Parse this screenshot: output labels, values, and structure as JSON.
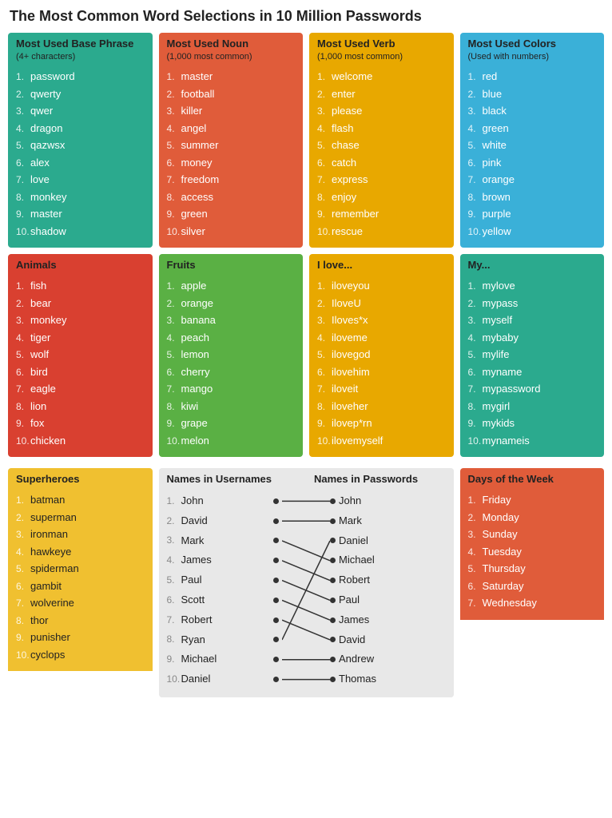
{
  "title": "The Most Common Word Selections in 10 Million Passwords",
  "sections": [
    {
      "id": "base-phrase",
      "header": "Most Used Base Phrase",
      "subheader": "(4+ characters)",
      "headerBg": "color-teal",
      "listBg": "color-teal",
      "items": [
        "password",
        "qwerty",
        "qwer",
        "dragon",
        "qazwsx",
        "alex",
        "love",
        "monkey",
        "master",
        "shadow"
      ]
    },
    {
      "id": "nouns",
      "header": "Most Used Noun",
      "subheader": "(1,000 most common)",
      "headerBg": "color-orange-red",
      "listBg": "color-orange-red",
      "items": [
        "master",
        "football",
        "killer",
        "angel",
        "summer",
        "money",
        "freedom",
        "access",
        "green",
        "silver"
      ]
    },
    {
      "id": "verbs",
      "header": "Most Used Verb",
      "subheader": "(1,000 most common)",
      "headerBg": "color-gold",
      "listBg": "color-gold",
      "items": [
        "welcome",
        "enter",
        "please",
        "flash",
        "chase",
        "catch",
        "express",
        "enjoy",
        "remember",
        "rescue"
      ]
    },
    {
      "id": "colors",
      "header": "Most Used Colors",
      "subheader": "(Used with numbers)",
      "headerBg": "color-blue",
      "listBg": "color-blue",
      "items": [
        "red",
        "blue",
        "black",
        "green",
        "white",
        "pink",
        "orange",
        "brown",
        "purple",
        "yellow"
      ]
    },
    {
      "id": "animals",
      "header": "Animals",
      "subheader": "",
      "headerBg": "color-red",
      "listBg": "color-red",
      "items": [
        "fish",
        "bear",
        "monkey",
        "tiger",
        "wolf",
        "bird",
        "eagle",
        "lion",
        "fox",
        "chicken"
      ]
    },
    {
      "id": "fruits",
      "header": "Fruits",
      "subheader": "",
      "headerBg": "color-green",
      "listBg": "color-green",
      "items": [
        "apple",
        "orange",
        "banana",
        "peach",
        "lemon",
        "cherry",
        "mango",
        "kiwi",
        "grape",
        "melon"
      ]
    },
    {
      "id": "ilove",
      "header": "I love...",
      "subheader": "",
      "headerBg": "color-gold",
      "listBg": "color-gold",
      "items": [
        "iloveyou",
        "IloveU",
        "Iloves*x",
        "iloveme",
        "ilovegod",
        "ilovehim",
        "iloveit",
        "iloveher",
        "ilovep*rn",
        "ilovemyself"
      ]
    },
    {
      "id": "my",
      "header": "My...",
      "subheader": "",
      "headerBg": "color-teal",
      "listBg": "color-teal",
      "items": [
        "mylove",
        "mypass",
        "myself",
        "mybaby",
        "mylife",
        "myname",
        "mypassword",
        "mygirl",
        "mykids",
        "mynameis"
      ]
    },
    {
      "id": "superheroes",
      "header": "Superheroes",
      "subheader": "",
      "headerBg": "color-yellow",
      "listBg": "color-yellow",
      "items": [
        "batman",
        "superman",
        "ironman",
        "hawkeye",
        "spiderman",
        "gambit",
        "wolverine",
        "thor",
        "punisher",
        "cyclops"
      ]
    },
    {
      "id": "days",
      "header": "Days of the Week",
      "subheader": "",
      "headerBg": "color-orange-red",
      "listBg": "color-orange-red",
      "items": [
        "Friday",
        "Monday",
        "Sunday",
        "Tuesday",
        "Thursday",
        "Saturday",
        "Wednesday"
      ]
    }
  ],
  "names": {
    "headerLeft": "Names in Usernames",
    "headerRight": "Names in Passwords",
    "left": [
      "John",
      "David",
      "Mark",
      "James",
      "Paul",
      "Scott",
      "Robert",
      "Ryan",
      "Michael",
      "Daniel"
    ],
    "right": [
      "John",
      "Mark",
      "Daniel",
      "Michael",
      "Robert",
      "Paul",
      "James",
      "David",
      "Andrew",
      "Thomas"
    ],
    "connections": [
      [
        0,
        0
      ],
      [
        1,
        1
      ],
      [
        2,
        3
      ],
      [
        3,
        4
      ],
      [
        4,
        5
      ],
      [
        5,
        6
      ],
      [
        6,
        7
      ],
      [
        7,
        2
      ],
      [
        8,
        8
      ],
      [
        9,
        9
      ]
    ]
  }
}
